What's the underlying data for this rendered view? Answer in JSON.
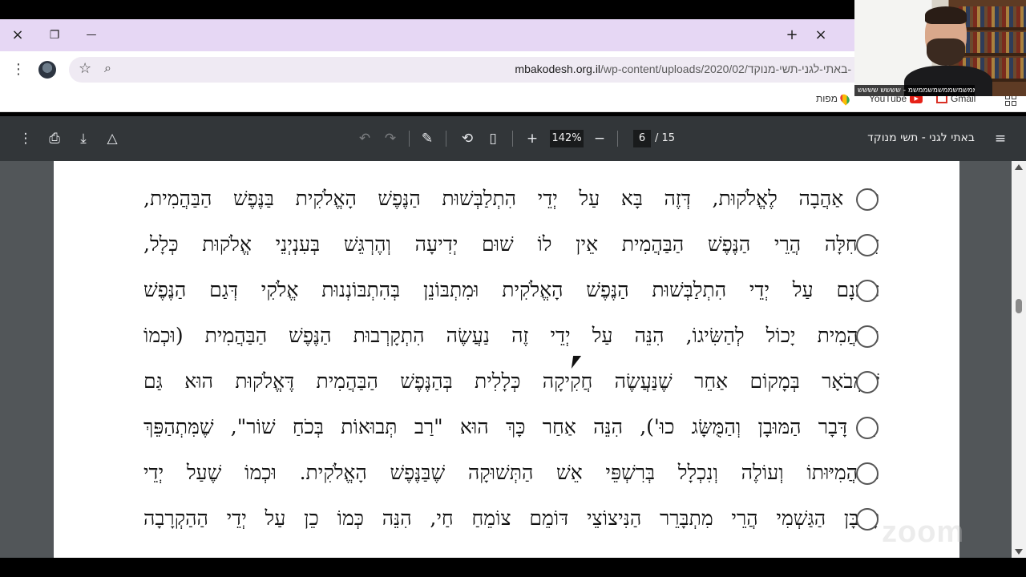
{
  "browser": {
    "tab_new_icon": "+",
    "tab_close_icon": "×",
    "window_close_icon": "×",
    "window_restore_icon": "❐",
    "window_minimize_icon": "—",
    "url_domain": "mbakodesh.org.il",
    "url_path": "/wp-content/uploads/2020/02/באתי-לגני-תשי-מנוקד-"
  },
  "bookmarks": {
    "youtube": "YouTube",
    "gmail": "Gmail",
    "maps": "מפות"
  },
  "pdf_toolbar": {
    "title": "באתי לגני - תשי מנוקד",
    "zoom": "142%",
    "page_current": "6",
    "page_total": "/ 15"
  },
  "document": {
    "lines": [
      "לוֹ אַהֲבָה לֶאֱלֹקוּת, דְּזֶה בָּא עַל יְדֵי הִתְלַבְּשׁוּת הַנֶּפֶשׁ הָאֱלֹקִית בַּנֶּפֶשׁ הַבַּהֲמִית,",
      "דִּתְחִלָּה הֲרֵי הַנֶּפֶשׁ הַבַּהֲמִית אֵין לוֹ שׁוּם יְדִיעָה וְהֶרְגֵּשׁ בְּעִנְיְנֵי אֱלֹקוּת כְּלָל,",
      "אָמְנָם עַל יְדֵי הִתְלַבְּשׁוּת הַנֶּפֶשׁ הָאֱלֹקִית וּמִתְבּוֹנֵן בְּהִתְבּוֹנְנוּת אֱלֹקִי דְּגַם הַנֶּפֶשׁ",
      "הַבַּהֲמִית יָכוֹל לְהַשִּׂיגוֹ, הִנֵּה עַל יְדֵי זֶה נַעֲשֶׂה הִתְקָרְבוּת הַנֶּפֶשׁ הַבַּהֲמִית (וּכְמוֹ",
      "שֶׁמְּבֹאָר בְּמָקוֹם אַחֵר שֶׁנַּעֲשֶׂה חֲקִיקָה כְּלָלִית בְּהַנֶּפֶשׁ הַבַּהֲמִית דֶּאֱלֹקוּת הוּא גַּם",
      "כֵּן דָּבָר הַמּוּבָן וְהַמֻּשָּׂג כוּ'), הִנֵּה אַחַר כָּךְ הוּא \"רַב תְּבוּאוֹת בְּכֹחַ שׁוֹר\", שֶׁמִּתְהַפֵּךְ",
      "מִבַּהֲמִיּוּתוֹ וְעוֹלֶה וְנִכְלָל בְּרִשְׁפֵּי אֵשׁ הַתְּשׁוּקָה שֶׁבַּנֶּפֶשׁ הָאֱלֹקִית. וּכְמוֹ שֶׁעַל יְדֵי",
      "קָרְבָּן הַגַּשְׁמִי הֲרֵי מִתְבָּרֵר הַנִּיצוֹצֵי דּוֹמֵם צוֹמֵחַ חַי, הִנֵּה כְּמוֹ כֵן עַל יְדֵי הַהַקְרָבָה"
    ]
  },
  "overlay": {
    "watermark": "zoom",
    "video_name": "ממשמשממשמשממשמ - שששש שששש"
  }
}
